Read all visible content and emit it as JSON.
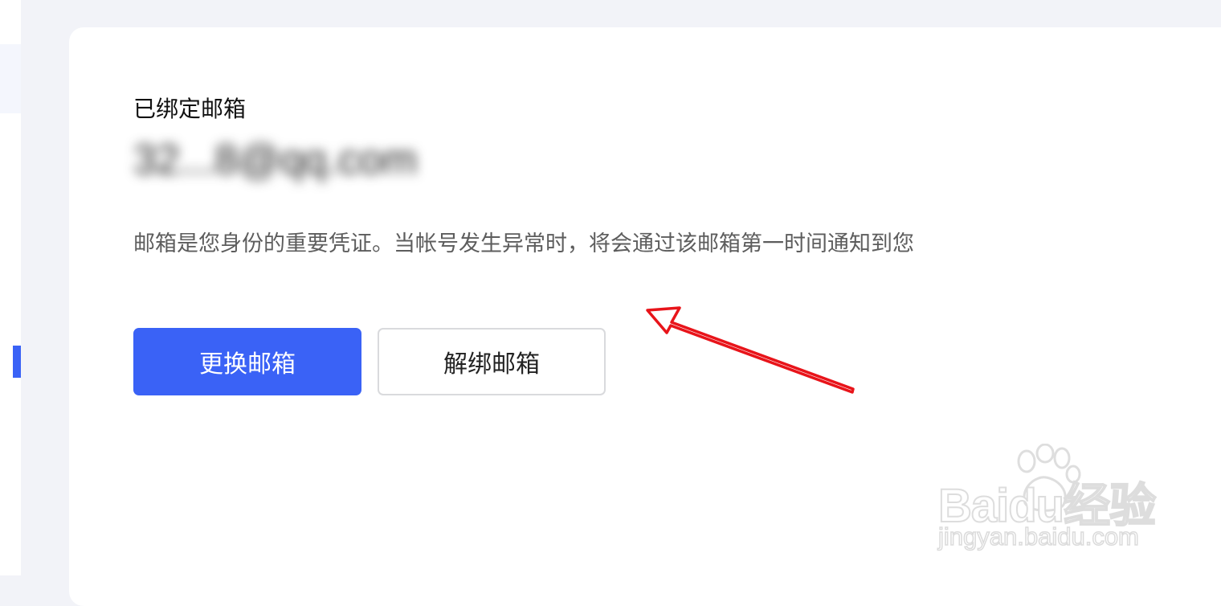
{
  "email_section": {
    "title": "已绑定邮箱",
    "bound_email_masked": "32...8@qq.com",
    "description": "邮箱是您身份的重要凭证。当帐号发生异常时，将会通过该邮箱第一时间通知到您"
  },
  "actions": {
    "change_email_label": "更换邮箱",
    "unbind_email_label": "解绑邮箱"
  },
  "watermark": {
    "brand": "Baidu经验",
    "url": "jingyan.baidu.com"
  },
  "colors": {
    "accent": "#3a62f6",
    "page_background": "#f2f3f8",
    "annotation_arrow": "#e8141a"
  },
  "icons": {
    "annotation": "red-arrow-icon",
    "watermark": "baidu-paw-icon"
  }
}
